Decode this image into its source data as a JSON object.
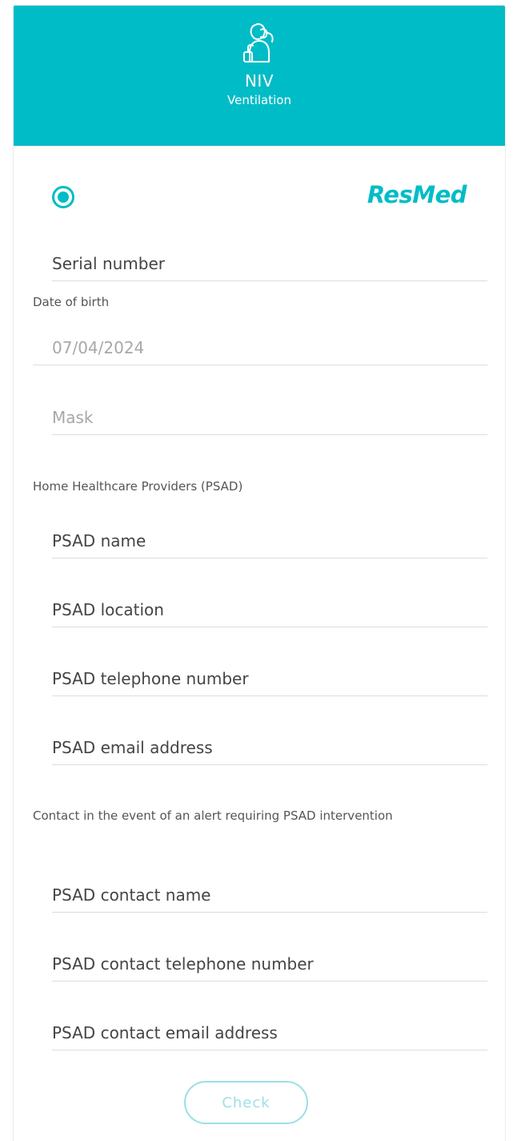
{
  "header": {
    "icon": "person-ventilation-icon",
    "title": "NIV",
    "subtitle": "Ventilation",
    "background_color": "#00bcc6"
  },
  "brand": {
    "radio_selected": true,
    "logo_text": "ResMed",
    "accent_color": "#00bcc6"
  },
  "fields": {
    "serial_number": {
      "placeholder": "Serial number",
      "value": ""
    },
    "date_of_birth": {
      "label": "Date of birth",
      "placeholder": "07/04/2024",
      "value": ""
    },
    "mask": {
      "placeholder": "Mask",
      "value": ""
    }
  },
  "psad": {
    "section_label": "Home Healthcare Providers (PSAD)",
    "name": {
      "placeholder": "PSAD name",
      "value": ""
    },
    "location": {
      "placeholder": "PSAD location",
      "value": ""
    },
    "telephone": {
      "placeholder": "PSAD telephone number",
      "value": ""
    },
    "email": {
      "placeholder": "PSAD email address",
      "value": ""
    }
  },
  "contact": {
    "section_label": "Contact in the event of an alert requiring PSAD intervention",
    "name": {
      "placeholder": "PSAD contact name",
      "value": ""
    },
    "telephone": {
      "placeholder": "PSAD contact telephone number",
      "value": ""
    },
    "email": {
      "placeholder": "PSAD contact email address",
      "value": ""
    }
  },
  "actions": {
    "check_label": "Check"
  }
}
